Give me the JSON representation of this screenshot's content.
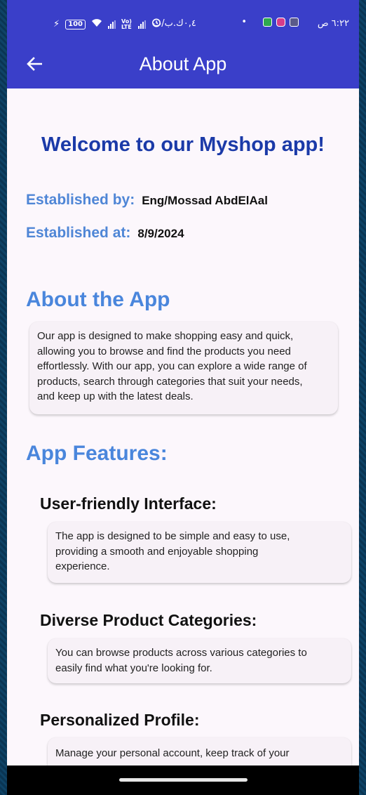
{
  "status_bar": {
    "time": "٦:٢٢ ص",
    "speed": "٠,٤ك.ب/ث",
    "battery": "100",
    "network": "Vo) LTE"
  },
  "app_bar": {
    "title": "About App",
    "back_icon": "arrow-left-icon"
  },
  "welcome": "Welcome to our Myshop app!",
  "established": {
    "by_label": "Established by:",
    "by_value": "Eng/Mossad AbdElAal",
    "at_label": "Established at:",
    "at_value": "8/9/2024"
  },
  "about": {
    "heading": "About the App",
    "lines": [
      "Our app is designed to make shopping easy and quick,",
      "allowing you to browse and find the products you need",
      "effortlessly. With our app, you can explore a wide range of",
      "products, search through categories that suit your needs,",
      "and keep up with the latest deals."
    ]
  },
  "features": {
    "heading": "App Features:",
    "items": [
      {
        "title": "User-friendly Interface:",
        "lines": [
          "The app is designed to be simple and easy to use,",
          "providing a smooth and enjoyable shopping",
          "experience."
        ]
      },
      {
        "title": "Diverse Product Categories:",
        "lines": [
          "You can browse products across various categories to",
          "easily find what you're looking for."
        ]
      },
      {
        "title": "Personalized Profile:",
        "lines": [
          "Manage your personal account, keep track of your"
        ]
      }
    ]
  },
  "colors": {
    "app_bar": "#3a3fc9",
    "welcome": "#1b3aa8",
    "accent": "#4a86dc",
    "background": "#fcf7fc",
    "card": "#f7f1f7"
  }
}
